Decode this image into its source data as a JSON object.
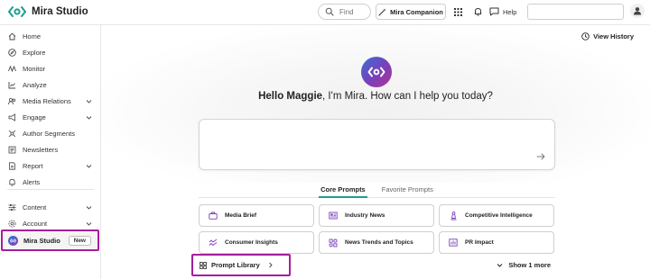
{
  "header": {
    "brand_name": "Mira Studio",
    "search_placeholder": "Find",
    "companion_label": "Mira Companion",
    "help_label": "Help",
    "icons": [
      "mira-logo-icon",
      "search-icon",
      "sparkle-wand-icon",
      "grid-icon",
      "bell-icon",
      "chat-bubble-icon",
      "user-icon"
    ]
  },
  "sidebar": {
    "items": [
      {
        "label": "Home",
        "icon": "home-icon"
      },
      {
        "label": "Explore",
        "icon": "compass-icon"
      },
      {
        "label": "Monitor",
        "icon": "pulse-icon"
      },
      {
        "label": "Analyze",
        "icon": "chart-icon"
      },
      {
        "label": "Media Relations",
        "icon": "people-icon",
        "expandable": true
      },
      {
        "label": "Engage",
        "icon": "megaphone-icon",
        "expandable": true
      },
      {
        "label": "Author Segments",
        "icon": "segments-icon"
      },
      {
        "label": "Newsletters",
        "icon": "newsletter-icon"
      },
      {
        "label": "Report",
        "icon": "report-icon",
        "expandable": true
      },
      {
        "label": "Alerts",
        "icon": "bell-icon"
      }
    ],
    "bottom_items": [
      {
        "label": "Content",
        "icon": "sliders-icon",
        "expandable": true
      },
      {
        "label": "Account",
        "icon": "gear-icon",
        "expandable": true
      }
    ],
    "active_item": {
      "label": "Mira Studio",
      "badge": "New"
    }
  },
  "main": {
    "view_history_label": "View History",
    "greeting_name": "Hello Maggie",
    "greeting_rest": ", I'm Mira. How can I help you today?",
    "prompt_placeholder": "",
    "tabs": [
      {
        "label": "Core Prompts",
        "active": true
      },
      {
        "label": "Favorite Prompts",
        "active": false
      }
    ],
    "cards": [
      {
        "label": "Media Brief",
        "icon": "briefcase-icon"
      },
      {
        "label": "Industry News",
        "icon": "newspaper-icon"
      },
      {
        "label": "Competitive Intelligence",
        "icon": "chess-icon"
      },
      {
        "label": "Consumer Insights",
        "icon": "trend-icon"
      },
      {
        "label": "News Trends and Topics",
        "icon": "topics-icon"
      },
      {
        "label": "PR Impact",
        "icon": "impact-icon"
      }
    ],
    "prompt_library_label": "Prompt Library",
    "show_more_label": "Show 1 more"
  },
  "colors": {
    "highlight": "#a51e9c",
    "tab_underline": "#1c9d8f",
    "brand_gradient_start": "#3b6fd6",
    "brand_gradient_end": "#b3338f",
    "icon_accent": "#7a3fb9"
  }
}
